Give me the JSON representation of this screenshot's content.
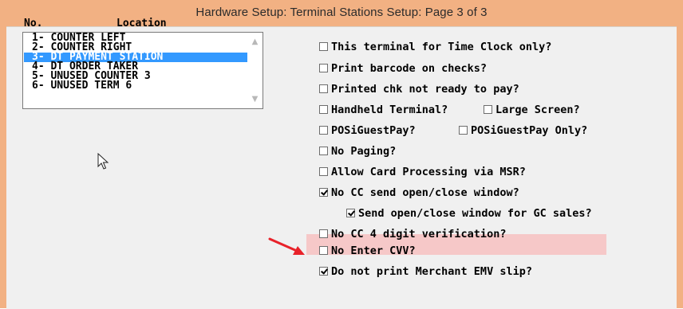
{
  "window": {
    "title": "Hardware Setup: Terminal Stations Setup: Page 3 of 3"
  },
  "list": {
    "header_no": "No.",
    "header_location": "Location",
    "items": [
      "1- COUNTER LEFT",
      "2- COUNTER RIGHT",
      "3- DT PAYMENT STATION",
      "4- DT ORDER TAKER",
      "5- UNUSED COUNTER 3",
      "6- UNUSED TERM 6"
    ],
    "selected_index": 2
  },
  "options": [
    {
      "label": "This terminal for Time Clock only?",
      "checked": false
    },
    {
      "label": "Print barcode on checks?",
      "checked": false
    },
    {
      "label": "Printed chk not ready to pay?",
      "checked": false
    },
    {
      "label": "Handheld Terminal?",
      "checked": false
    },
    {
      "label": "Large Screen?",
      "checked": false
    },
    {
      "label": "POSiGuestPay?",
      "checked": false
    },
    {
      "label": "POSiGuestPay Only?",
      "checked": false
    },
    {
      "label": "No Paging?",
      "checked": false
    },
    {
      "label": "Allow Card Processing via MSR?",
      "checked": false
    },
    {
      "label": "No CC send open/close window?",
      "checked": true
    },
    {
      "label": "Send open/close window for GC sales?",
      "checked": true
    },
    {
      "label": "No CC 4 digit verification?",
      "checked": false
    },
    {
      "label": "No Enter CVV?",
      "checked": false
    },
    {
      "label": "Do not print Merchant EMV slip?",
      "checked": true
    }
  ],
  "colors": {
    "titlebar": "#f2b183",
    "selection": "#3399ff",
    "highlight": "#f6c8c8",
    "arrow": "#e8222a"
  },
  "icons": {
    "pointer": "mouse-pointer-icon",
    "arrow": "red-arrow-icon"
  }
}
